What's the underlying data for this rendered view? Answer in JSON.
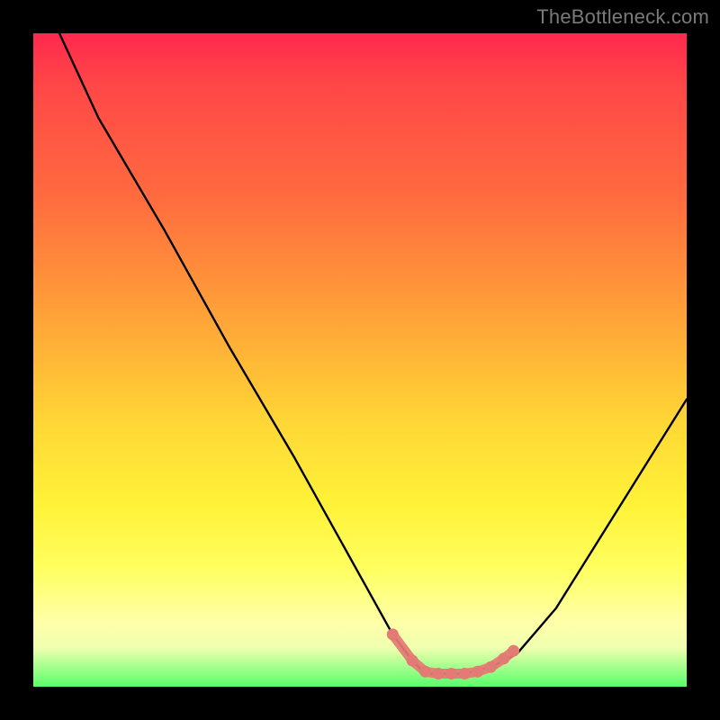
{
  "watermark": "TheBottleneck.com",
  "colors": {
    "frame": "#000000",
    "curve_stroke": "#000000",
    "marker_fill": "#e47a74",
    "marker_stroke": "#e47a74"
  },
  "chart_data": {
    "type": "line",
    "title": "",
    "xlabel": "",
    "ylabel": "",
    "xlim": [
      0,
      100
    ],
    "ylim": [
      0,
      100
    ],
    "series": [
      {
        "name": "bottleneck-curve",
        "x": [
          4,
          10,
          20,
          30,
          40,
          50,
          55,
          58,
          60,
          63,
          66,
          70,
          74,
          80,
          90,
          100
        ],
        "y": [
          100,
          87,
          70,
          52,
          35,
          17,
          8,
          4,
          2,
          2,
          2,
          3,
          5,
          12,
          28,
          44
        ]
      }
    ],
    "markers": {
      "comment": "salmon dots along valley bottom",
      "x": [
        55,
        58,
        60,
        62,
        64,
        66,
        68,
        70,
        72,
        73.5
      ],
      "y": [
        8,
        4,
        2.3,
        2,
        2,
        2,
        2.3,
        3,
        4.3,
        5.5
      ]
    }
  }
}
